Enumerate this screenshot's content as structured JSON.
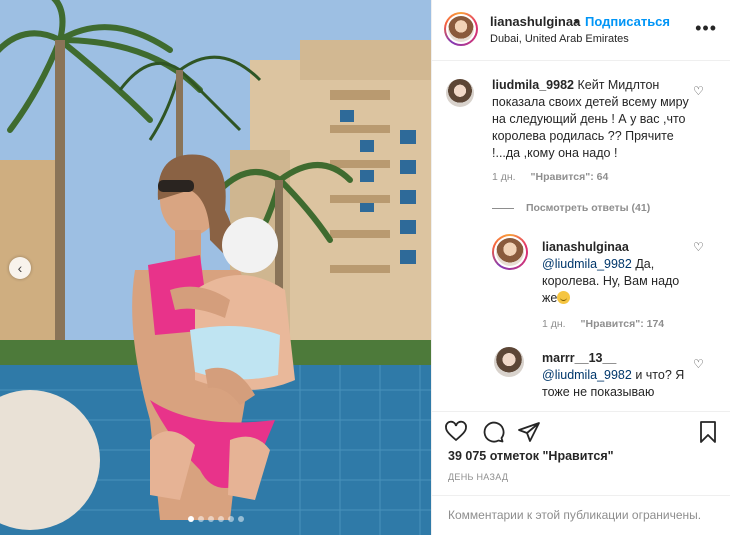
{
  "post": {
    "author": "lianashulginaa",
    "separator": "•",
    "follow_label": "Подписаться",
    "location": "Dubai, United Arab Emirates",
    "more_icon": "more-icon"
  },
  "photo": {
    "slides_total": 6,
    "active_slide": 1,
    "prev_icon": "chevron-left-icon"
  },
  "comments": [
    {
      "username": "liudmila_9982",
      "text": "Кейт Мидлтон показала своих детей всему миру на следующий день ! А у вас ,что королева родилась ?? Прячите !...да ,кому она надо !",
      "time": "1 дн.",
      "likes": "\"Нравится\": 64",
      "view_replies": "Посмотреть ответы (41)"
    },
    {
      "username": "lianashulginaa",
      "mention": "@liudmila_9982",
      "text": "Да, королева. Ну, Вам надо же",
      "time": "1 дн.",
      "likes": "\"Нравится\": 174"
    },
    {
      "username": "marrr__13__",
      "mention": "@liudmila_9982",
      "text": "и что? Я тоже не показываю"
    }
  ],
  "actions": {
    "likes_count": "39 075 отметок \"Нравится\"",
    "time_ago": "ДЕНЬ НАЗАД"
  },
  "footer": {
    "restricted": "Комментарии к этой публикации ограничены."
  },
  "colors": {
    "link": "#0095f6",
    "mention": "#00376b",
    "muted": "#8e8e8e",
    "border": "#efefef",
    "swimsuit": "#e8338a"
  }
}
